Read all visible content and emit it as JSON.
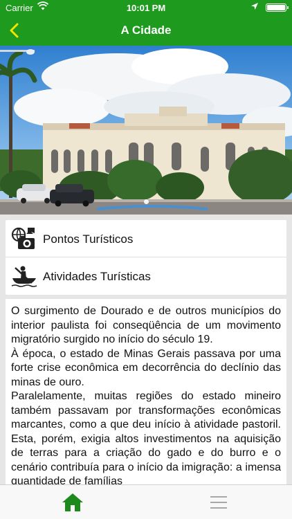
{
  "status_bar": {
    "carrier": "Carrier",
    "time": "10:01 PM"
  },
  "nav": {
    "title": "A Cidade",
    "back_icon": "chevron-left-icon",
    "accent": "#1e9a1e",
    "back_color": "#f2e600"
  },
  "carousel": {
    "pages": 1,
    "current": 1
  },
  "menu": {
    "items": [
      {
        "label": "Pontos Turísticos",
        "icon": "camera-globe-icon"
      },
      {
        "label": "Atividades Turísticas",
        "icon": "canoe-icon"
      }
    ]
  },
  "content": {
    "paragraphs": [
      "O surgimento de Dourado e de outros municípios do interior paulista foi conseqüência de um movimento migratório surgido no início do século 19.",
      "À época, o estado de Minas Gerais passava por uma forte crise econômica em decorrência do declínio das minas de ouro.",
      "Paralelamente, muitas regiões do estado mineiro também passavam por transformações econômicas marcantes, como a que deu início à atividade pastoril. Esta, porém, exigia altos investimentos na aquisição de terras para a criação do gado e do burro e o cenário contribuía para o início da imigração: a imensa quantidade de famílias"
    ]
  },
  "tab_bar": {
    "items": [
      {
        "icon": "home-icon",
        "active": true
      },
      {
        "icon": "hamburger-menu-icon",
        "active": false
      }
    ],
    "active_color": "#1e8a1e",
    "inactive_color": "#a8a8a8"
  }
}
